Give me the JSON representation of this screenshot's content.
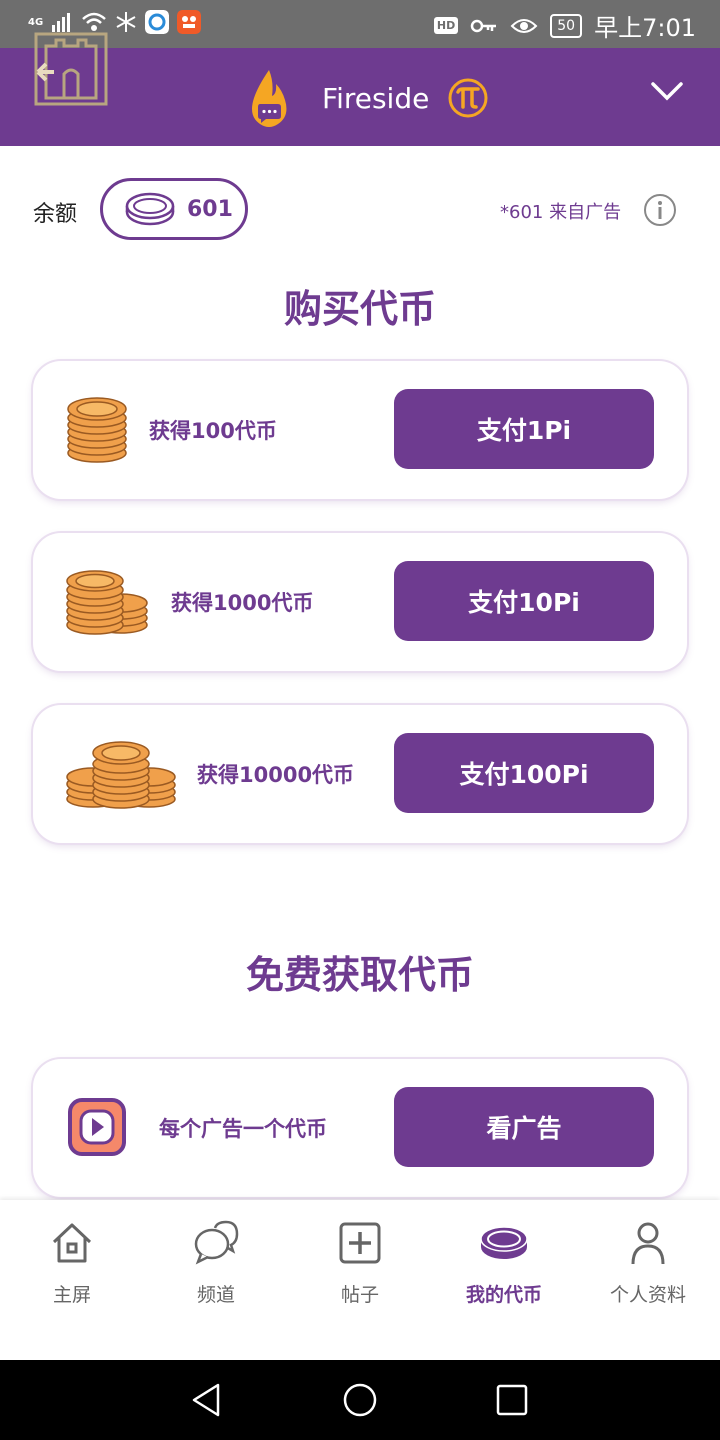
{
  "status_bar": {
    "network": "4G",
    "hd": "HD",
    "battery": "50",
    "time": "早上7:01"
  },
  "header": {
    "title": "Fireside"
  },
  "balance": {
    "label": "余额",
    "value": "601",
    "ad_note": "*601 来自广告"
  },
  "buy_section": {
    "title": "购买代币",
    "offers": [
      {
        "label": "获得100代币",
        "button": "支付1Pi"
      },
      {
        "label": "获得1000代币",
        "button": "支付10Pi"
      },
      {
        "label": "获得10000代币",
        "button": "支付100Pi"
      }
    ]
  },
  "free_section": {
    "title": "免费获取代币",
    "offer": {
      "label": "每个广告一个代币",
      "button": "看广告"
    }
  },
  "nav": {
    "items": [
      {
        "label": "主屏",
        "icon": "home-icon"
      },
      {
        "label": "频道",
        "icon": "chat-bubbles-icon"
      },
      {
        "label": "帖子",
        "icon": "add-post-icon"
      },
      {
        "label": "我的代币",
        "icon": "coin-icon"
      },
      {
        "label": "个人资料",
        "icon": "profile-icon"
      }
    ],
    "active_index": 3
  },
  "colors": {
    "primary": "#6e3b90",
    "coin": "#f0a04b",
    "flame": "#f5a623"
  }
}
